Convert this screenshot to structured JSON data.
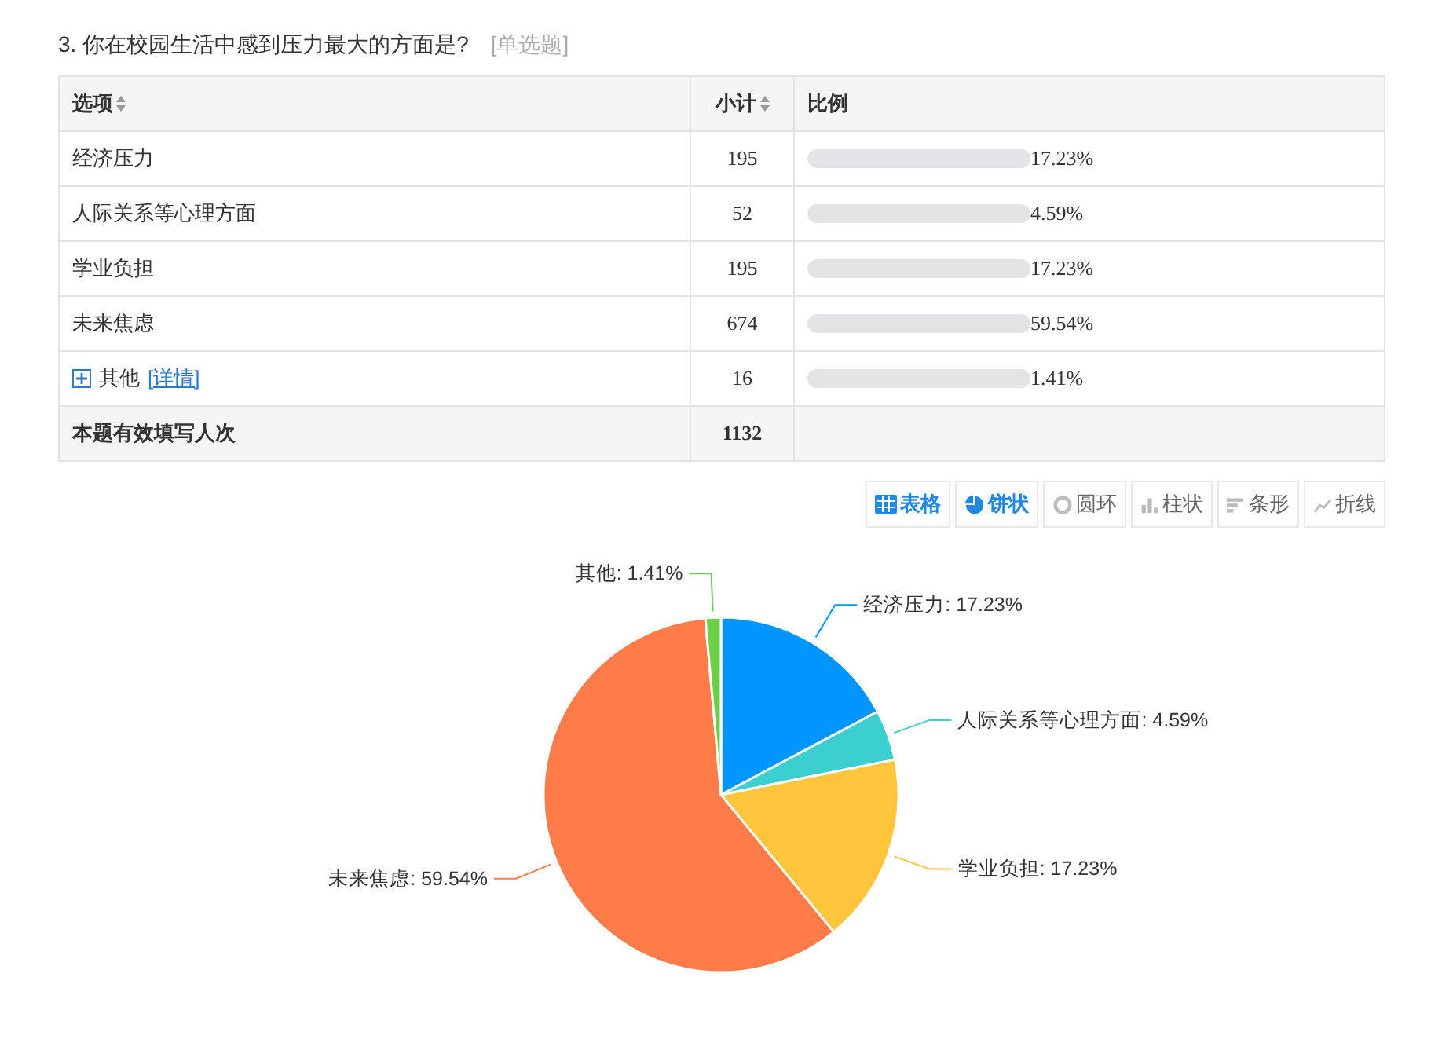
{
  "question": {
    "title": "3. 你在校园生活中感到压力最大的方面是?",
    "type_tag": "[单选题]"
  },
  "table": {
    "columns": [
      "选项",
      "小计",
      "比例"
    ],
    "rows": [
      {
        "option": "经济压力",
        "count": "195",
        "level": 0,
        "percent": "17.23%"
      },
      {
        "option": "人际关系等心理方面",
        "count": "52",
        "level": 0,
        "percent": "4.59%"
      },
      {
        "option": "学业负担",
        "count": "195",
        "level": 0,
        "percent": "17.23%"
      },
      {
        "option": "未来焦虑",
        "count": "674",
        "level": 0,
        "percent": "59.54%"
      },
      {
        "option": "其他",
        "link": "[详情]",
        "expandable": true,
        "count": "16",
        "level": 0,
        "percent": "1.41%"
      }
    ],
    "total": {
      "label": "本题有效填写人次",
      "count": "1132"
    }
  },
  "view_buttons": [
    {
      "kind": "table",
      "label": "表格",
      "selected": true
    },
    {
      "kind": "pie",
      "label": "饼状",
      "selected": true
    },
    {
      "kind": "ring",
      "label": "圆环",
      "selected": false
    },
    {
      "kind": "column",
      "label": "柱状",
      "selected": false
    },
    {
      "kind": "bar",
      "label": "条形",
      "selected": false
    },
    {
      "kind": "line",
      "label": "折线",
      "selected": false
    }
  ],
  "chart_data": {
    "type": "pie",
    "values": [
      17.23,
      4.59,
      17.23,
      59.54,
      1.41
    ],
    "colors": [
      "#0095ff",
      "#3ccfcf",
      "#ffc53d",
      "#ff7b47",
      "#6ad146"
    ],
    "value_labels": [
      "经济压力: 17.23%",
      "人际关系等心理方面: 4.59%",
      "学业负担: 17.23%",
      "未来焦虑: 59.54%",
      "其他: 1.41%"
    ]
  }
}
